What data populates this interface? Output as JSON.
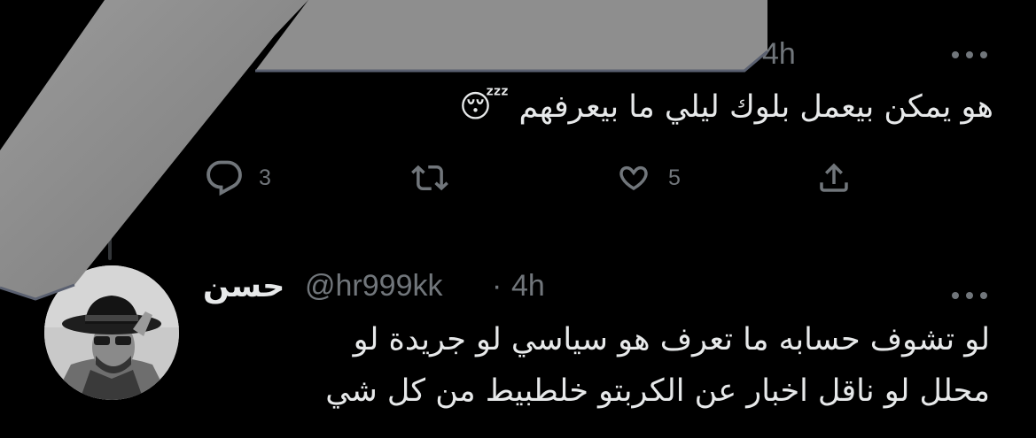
{
  "tweet1": {
    "time": "4h",
    "text": "هو يمكن بيعمل بلوك ليلي ما بيعرفهم 😴",
    "actions": {
      "reply_count": "3",
      "retweet_count": "",
      "like_count": "5"
    },
    "icons": [
      "reply-icon",
      "retweet-icon",
      "like-icon",
      "share-icon",
      "more-icon"
    ]
  },
  "tweet2": {
    "display_name": "حسن",
    "handle": "@hr999kk",
    "separator": "·",
    "time": "4h",
    "text_line1": "لو تشوف حسابه ما تعرف هو سياسي لو جريدة لو",
    "text_line2": "محلل لو ناقل اخبار عن الكربتو خلطبيط من كل شي"
  },
  "colors": {
    "background": "#000000",
    "text": "#e7e9ea",
    "muted": "#71767b",
    "overlay": "#8e8e8e"
  }
}
